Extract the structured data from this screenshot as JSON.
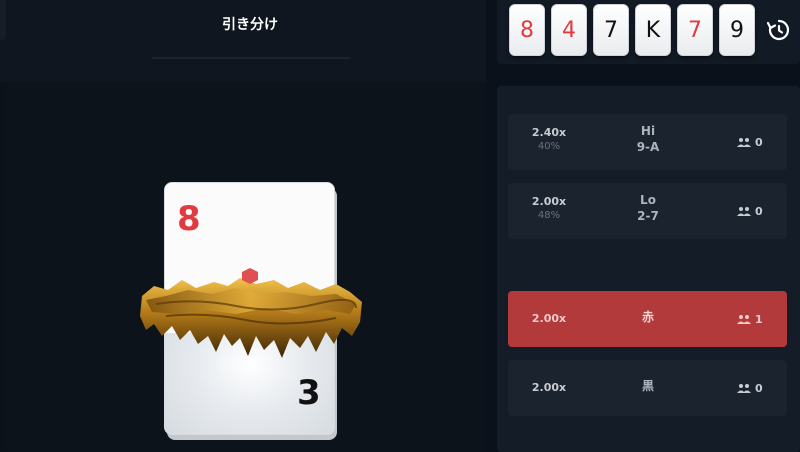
{
  "header": {
    "title": "引き分け"
  },
  "history": {
    "cards": [
      {
        "rank": "8",
        "color": "red"
      },
      {
        "rank": "4",
        "color": "red"
      },
      {
        "rank": "7",
        "color": "black"
      },
      {
        "rank": "K",
        "color": "black"
      },
      {
        "rank": "7",
        "color": "red"
      },
      {
        "rank": "9",
        "color": "black"
      }
    ],
    "icon": "history-icon"
  },
  "current_card": {
    "revealed_rank": "8",
    "revealed_color": "red",
    "next_rank": "3",
    "next_color": "black"
  },
  "bets": [
    {
      "odds": "2.40x",
      "chance": "40%",
      "name_line1": "Hi",
      "name_line2": "9-A",
      "players": "0",
      "active": false
    },
    {
      "odds": "2.00x",
      "chance": "48%",
      "name_line1": "Lo",
      "name_line2": "2-7",
      "players": "0",
      "active": false
    },
    {
      "odds": "2.00x",
      "chance": "",
      "name_line1": "赤",
      "name_line2": "",
      "players": "1",
      "active": true
    },
    {
      "odds": "2.00x",
      "chance": "",
      "name_line1": "黒",
      "name_line2": "",
      "players": "0",
      "active": false
    }
  ],
  "colors": {
    "background": "#0b111a",
    "red_suit": "#e23b3f",
    "active_bet": "#b23a3a"
  }
}
